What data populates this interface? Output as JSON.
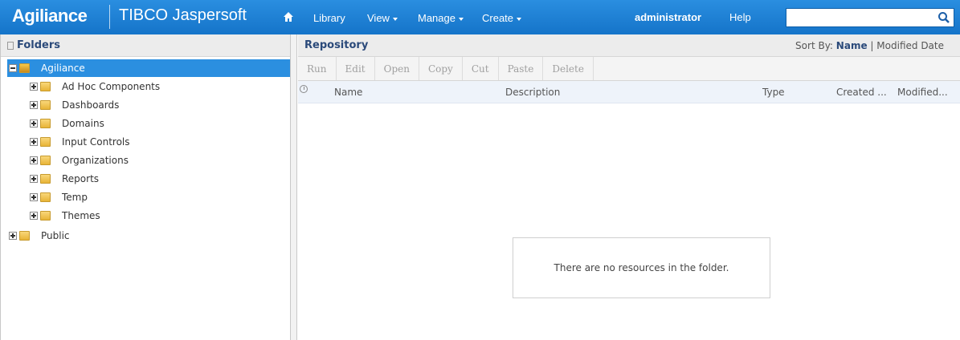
{
  "brand": {
    "name": "Agiliance",
    "product": "TIBCO Jaspersoft"
  },
  "nav": {
    "library": "Library",
    "view": "View",
    "manage": "Manage",
    "create": "Create",
    "user": "administrator",
    "help": "Help"
  },
  "search": {
    "value": "",
    "placeholder": ""
  },
  "folders": {
    "title": "Folders",
    "root": "Agiliance",
    "children": [
      "Ad Hoc Components",
      "Dashboards",
      "Domains",
      "Input Controls",
      "Organizations",
      "Reports",
      "Temp",
      "Themes"
    ],
    "public": "Public"
  },
  "repository": {
    "title": "Repository",
    "sort_label": "Sort By:",
    "sort_name": "Name",
    "sort_sep": "|",
    "sort_modified": "Modified Date",
    "toolbar": [
      "Run",
      "Edit",
      "Open",
      "Copy",
      "Cut",
      "Paste",
      "Delete"
    ],
    "columns": {
      "name": "Name",
      "description": "Description",
      "type": "Type",
      "created": "Created ...",
      "modified": "Modified..."
    },
    "empty_message": "There are no resources in the folder."
  },
  "colors": {
    "accent": "#1c7fd6",
    "selected": "#2b8fe0"
  }
}
